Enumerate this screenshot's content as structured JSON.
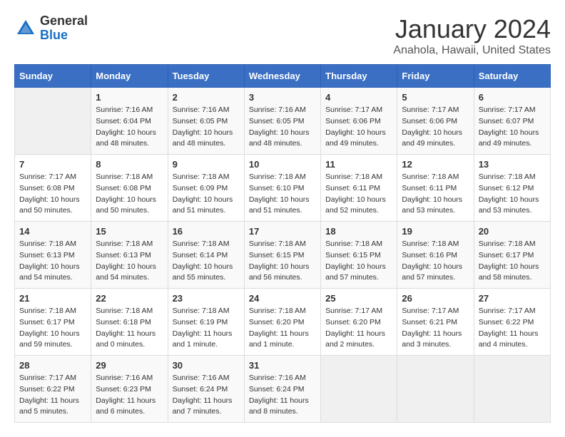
{
  "app": {
    "name_general": "General",
    "name_blue": "Blue"
  },
  "header": {
    "month_year": "January 2024",
    "location": "Anahola, Hawaii, United States"
  },
  "days_of_week": [
    "Sunday",
    "Monday",
    "Tuesday",
    "Wednesday",
    "Thursday",
    "Friday",
    "Saturday"
  ],
  "weeks": [
    [
      {
        "day": "",
        "sunrise": "",
        "sunset": "",
        "daylight": ""
      },
      {
        "day": "1",
        "sunrise": "Sunrise: 7:16 AM",
        "sunset": "Sunset: 6:04 PM",
        "daylight": "Daylight: 10 hours and 48 minutes."
      },
      {
        "day": "2",
        "sunrise": "Sunrise: 7:16 AM",
        "sunset": "Sunset: 6:05 PM",
        "daylight": "Daylight: 10 hours and 48 minutes."
      },
      {
        "day": "3",
        "sunrise": "Sunrise: 7:16 AM",
        "sunset": "Sunset: 6:05 PM",
        "daylight": "Daylight: 10 hours and 48 minutes."
      },
      {
        "day": "4",
        "sunrise": "Sunrise: 7:17 AM",
        "sunset": "Sunset: 6:06 PM",
        "daylight": "Daylight: 10 hours and 49 minutes."
      },
      {
        "day": "5",
        "sunrise": "Sunrise: 7:17 AM",
        "sunset": "Sunset: 6:06 PM",
        "daylight": "Daylight: 10 hours and 49 minutes."
      },
      {
        "day": "6",
        "sunrise": "Sunrise: 7:17 AM",
        "sunset": "Sunset: 6:07 PM",
        "daylight": "Daylight: 10 hours and 49 minutes."
      }
    ],
    [
      {
        "day": "7",
        "sunrise": "Sunrise: 7:17 AM",
        "sunset": "Sunset: 6:08 PM",
        "daylight": "Daylight: 10 hours and 50 minutes."
      },
      {
        "day": "8",
        "sunrise": "Sunrise: 7:18 AM",
        "sunset": "Sunset: 6:08 PM",
        "daylight": "Daylight: 10 hours and 50 minutes."
      },
      {
        "day": "9",
        "sunrise": "Sunrise: 7:18 AM",
        "sunset": "Sunset: 6:09 PM",
        "daylight": "Daylight: 10 hours and 51 minutes."
      },
      {
        "day": "10",
        "sunrise": "Sunrise: 7:18 AM",
        "sunset": "Sunset: 6:10 PM",
        "daylight": "Daylight: 10 hours and 51 minutes."
      },
      {
        "day": "11",
        "sunrise": "Sunrise: 7:18 AM",
        "sunset": "Sunset: 6:11 PM",
        "daylight": "Daylight: 10 hours and 52 minutes."
      },
      {
        "day": "12",
        "sunrise": "Sunrise: 7:18 AM",
        "sunset": "Sunset: 6:11 PM",
        "daylight": "Daylight: 10 hours and 53 minutes."
      },
      {
        "day": "13",
        "sunrise": "Sunrise: 7:18 AM",
        "sunset": "Sunset: 6:12 PM",
        "daylight": "Daylight: 10 hours and 53 minutes."
      }
    ],
    [
      {
        "day": "14",
        "sunrise": "Sunrise: 7:18 AM",
        "sunset": "Sunset: 6:13 PM",
        "daylight": "Daylight: 10 hours and 54 minutes."
      },
      {
        "day": "15",
        "sunrise": "Sunrise: 7:18 AM",
        "sunset": "Sunset: 6:13 PM",
        "daylight": "Daylight: 10 hours and 54 minutes."
      },
      {
        "day": "16",
        "sunrise": "Sunrise: 7:18 AM",
        "sunset": "Sunset: 6:14 PM",
        "daylight": "Daylight: 10 hours and 55 minutes."
      },
      {
        "day": "17",
        "sunrise": "Sunrise: 7:18 AM",
        "sunset": "Sunset: 6:15 PM",
        "daylight": "Daylight: 10 hours and 56 minutes."
      },
      {
        "day": "18",
        "sunrise": "Sunrise: 7:18 AM",
        "sunset": "Sunset: 6:15 PM",
        "daylight": "Daylight: 10 hours and 57 minutes."
      },
      {
        "day": "19",
        "sunrise": "Sunrise: 7:18 AM",
        "sunset": "Sunset: 6:16 PM",
        "daylight": "Daylight: 10 hours and 57 minutes."
      },
      {
        "day": "20",
        "sunrise": "Sunrise: 7:18 AM",
        "sunset": "Sunset: 6:17 PM",
        "daylight": "Daylight: 10 hours and 58 minutes."
      }
    ],
    [
      {
        "day": "21",
        "sunrise": "Sunrise: 7:18 AM",
        "sunset": "Sunset: 6:17 PM",
        "daylight": "Daylight: 10 hours and 59 minutes."
      },
      {
        "day": "22",
        "sunrise": "Sunrise: 7:18 AM",
        "sunset": "Sunset: 6:18 PM",
        "daylight": "Daylight: 11 hours and 0 minutes."
      },
      {
        "day": "23",
        "sunrise": "Sunrise: 7:18 AM",
        "sunset": "Sunset: 6:19 PM",
        "daylight": "Daylight: 11 hours and 1 minute."
      },
      {
        "day": "24",
        "sunrise": "Sunrise: 7:18 AM",
        "sunset": "Sunset: 6:20 PM",
        "daylight": "Daylight: 11 hours and 1 minute."
      },
      {
        "day": "25",
        "sunrise": "Sunrise: 7:17 AM",
        "sunset": "Sunset: 6:20 PM",
        "daylight": "Daylight: 11 hours and 2 minutes."
      },
      {
        "day": "26",
        "sunrise": "Sunrise: 7:17 AM",
        "sunset": "Sunset: 6:21 PM",
        "daylight": "Daylight: 11 hours and 3 minutes."
      },
      {
        "day": "27",
        "sunrise": "Sunrise: 7:17 AM",
        "sunset": "Sunset: 6:22 PM",
        "daylight": "Daylight: 11 hours and 4 minutes."
      }
    ],
    [
      {
        "day": "28",
        "sunrise": "Sunrise: 7:17 AM",
        "sunset": "Sunset: 6:22 PM",
        "daylight": "Daylight: 11 hours and 5 minutes."
      },
      {
        "day": "29",
        "sunrise": "Sunrise: 7:16 AM",
        "sunset": "Sunset: 6:23 PM",
        "daylight": "Daylight: 11 hours and 6 minutes."
      },
      {
        "day": "30",
        "sunrise": "Sunrise: 7:16 AM",
        "sunset": "Sunset: 6:24 PM",
        "daylight": "Daylight: 11 hours and 7 minutes."
      },
      {
        "day": "31",
        "sunrise": "Sunrise: 7:16 AM",
        "sunset": "Sunset: 6:24 PM",
        "daylight": "Daylight: 11 hours and 8 minutes."
      },
      {
        "day": "",
        "sunrise": "",
        "sunset": "",
        "daylight": ""
      },
      {
        "day": "",
        "sunrise": "",
        "sunset": "",
        "daylight": ""
      },
      {
        "day": "",
        "sunrise": "",
        "sunset": "",
        "daylight": ""
      }
    ]
  ]
}
